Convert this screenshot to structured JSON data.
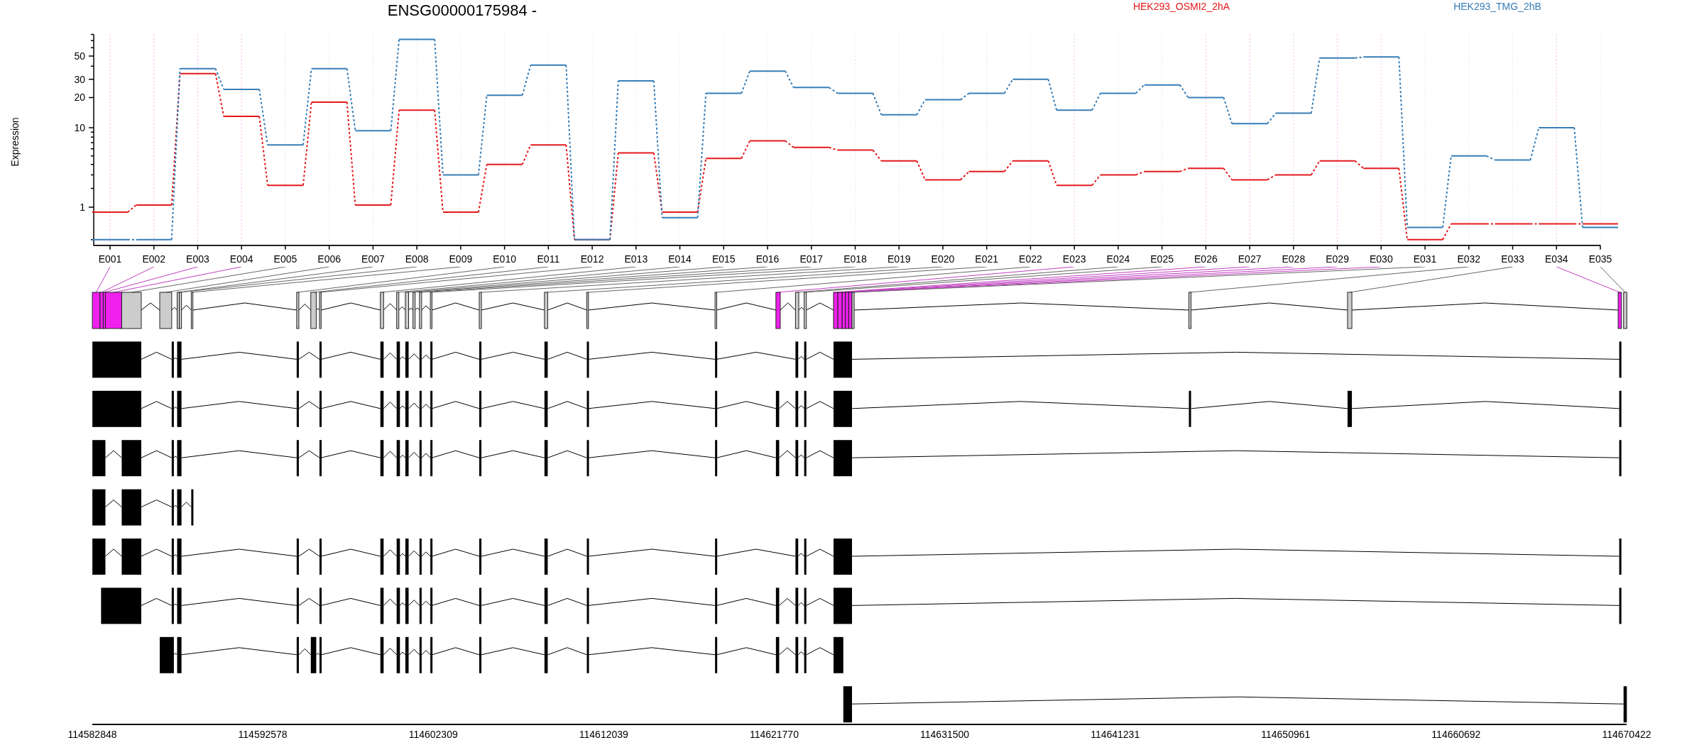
{
  "figure": {
    "title": "ENSG00000175984 -"
  },
  "expression_plot": {
    "legend": [
      {
        "label": "HEK293_OSMI2_2hA",
        "color": "#e41a1c"
      },
      {
        "label": "HEK293_TMG_2hB",
        "color": "#377eb8"
      }
    ],
    "ylabel": "Expression",
    "y_tick_labels": [
      "50",
      "30",
      "20",
      "10",
      "1"
    ],
    "exon_labels": [
      "E001",
      "E002",
      "E003",
      "E004",
      "E005",
      "E006",
      "E007",
      "E008",
      "E009",
      "E010",
      "E011",
      "E012",
      "E013",
      "E014",
      "E015",
      "E016",
      "E017",
      "E018",
      "E019",
      "E020",
      "E021",
      "E022",
      "E023",
      "E024",
      "E025",
      "E026",
      "E027",
      "E028",
      "E029",
      "E030",
      "E031",
      "E032",
      "E033",
      "E034",
      "E035"
    ]
  },
  "exons": [
    {
      "significant": true
    },
    {
      "significant": true
    },
    {
      "significant": true
    },
    {
      "significant": true
    },
    {
      "significant": false
    },
    {
      "significant": false
    },
    {
      "significant": false
    },
    {
      "significant": false
    },
    {
      "significant": false
    },
    {
      "significant": false
    },
    {
      "significant": false
    },
    {
      "significant": false
    },
    {
      "significant": false
    },
    {
      "significant": false
    },
    {
      "significant": false
    },
    {
      "significant": false
    },
    {
      "significant": false
    },
    {
      "significant": false
    },
    {
      "significant": false
    },
    {
      "significant": false
    },
    {
      "significant": false
    },
    {
      "significant": false
    },
    {
      "significant": true
    },
    {
      "significant": false
    },
    {
      "significant": false
    },
    {
      "significant": true
    },
    {
      "significant": true
    },
    {
      "significant": true
    },
    {
      "significant": true
    },
    {
      "significant": true
    },
    {
      "significant": false
    },
    {
      "significant": false
    },
    {
      "significant": false
    },
    {
      "significant": true
    },
    {
      "significant": false
    }
  ],
  "genomic_axis": {
    "labels": [
      "114582848",
      "114592578",
      "114602309",
      "114612039",
      "114621770",
      "114631500",
      "114641231",
      "114650961",
      "114660692",
      "114670422"
    ]
  }
}
